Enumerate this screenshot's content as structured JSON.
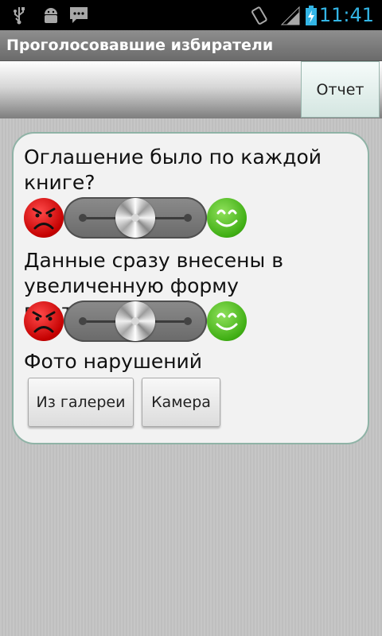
{
  "status_bar": {
    "time": "11:41",
    "icons": [
      "usb-icon",
      "android-debug-icon",
      "sms-icon",
      "rotation-icon",
      "signal-icon",
      "battery-charging-icon"
    ],
    "accent_color": "#33b5e5"
  },
  "app": {
    "title": "Проголосовавшие избиратели"
  },
  "toolbar": {
    "report_label": "Отчет"
  },
  "questions": [
    {
      "text": "Оглашение было по каждой книге?",
      "slider_value": 0.5
    },
    {
      "text": "Данные сразу внесены в увеличенную форму протокола?",
      "slider_value": 0.5
    }
  ],
  "photos": {
    "label": "Фото нарушений",
    "gallery_label": "Из галереи",
    "camera_label": "Камера"
  },
  "colors": {
    "card_border": "#8fb3a6",
    "sad_face": "#d40000",
    "happy_face": "#4cb81c"
  }
}
